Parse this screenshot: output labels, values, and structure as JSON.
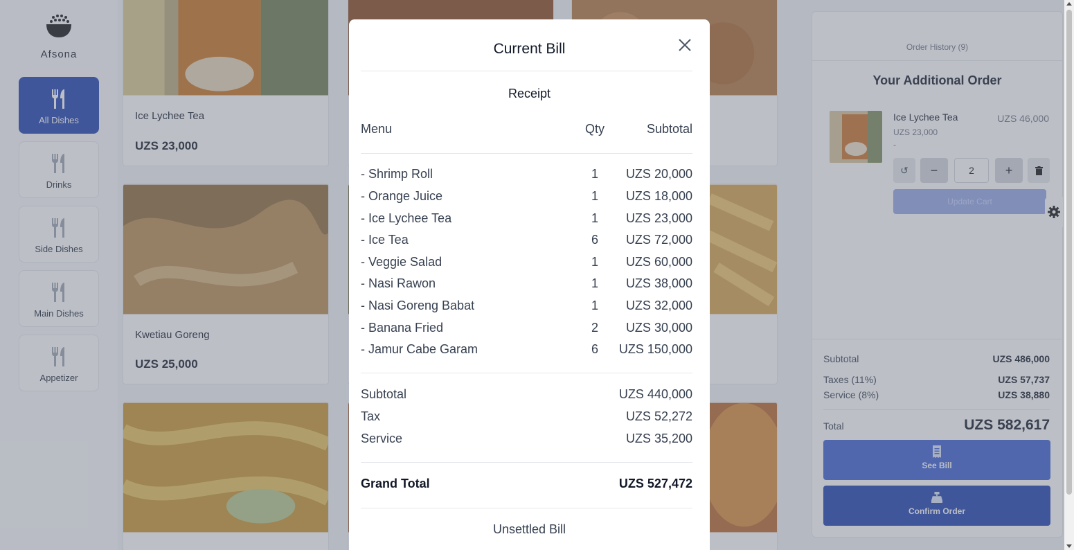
{
  "app": {
    "brand": "Afsona"
  },
  "categories": [
    {
      "label": "All Dishes",
      "icon": "utensils-icon",
      "active": true
    },
    {
      "label": "Drinks",
      "icon": "utensils-icon",
      "active": false
    },
    {
      "label": "Side Dishes",
      "icon": "utensils-icon",
      "active": false
    },
    {
      "label": "Main Dishes",
      "icon": "utensils-icon",
      "active": false
    },
    {
      "label": "Appetizer",
      "icon": "utensils-icon",
      "active": false
    }
  ],
  "menu_cards": [
    {
      "name": "Ice Lychee Tea",
      "price": "UZS 23,000"
    },
    {
      "name": "Kwetiau Goreng",
      "price": "UZS 25,000"
    }
  ],
  "cart": {
    "order_history": "Order History (9)",
    "title": "Your Additional Order",
    "item": {
      "name": "Ice Lychee Tea",
      "unit_price": "UZS 23,000",
      "note": "-",
      "total": "UZS 46,000",
      "qty": "2"
    },
    "update_label": "Update Cart",
    "subtotal_label": "Subtotal",
    "subtotal": "UZS 486,000",
    "tax_label": "Taxes (11%)",
    "tax": "UZS 57,737",
    "service_label": "Service (8%)",
    "service": "UZS 38,880",
    "total_label": "Total",
    "total": "UZS 582,617",
    "see_bill": "See Bill",
    "confirm": "Confirm Order"
  },
  "bill": {
    "title": "Current Bill",
    "receipt": "Receipt",
    "headers": {
      "menu": "Menu",
      "qty": "Qty",
      "subtotal": "Subtotal"
    },
    "items": [
      {
        "name": "- Shrimp Roll",
        "qty": "1",
        "subtotal": "UZS 20,000"
      },
      {
        "name": "- Orange Juice",
        "qty": "1",
        "subtotal": "UZS 18,000"
      },
      {
        "name": "- Ice Lychee Tea",
        "qty": "1",
        "subtotal": "UZS 23,000"
      },
      {
        "name": "- Ice Tea",
        "qty": "6",
        "subtotal": "UZS 72,000"
      },
      {
        "name": "- Veggie Salad",
        "qty": "1",
        "subtotal": "UZS 60,000"
      },
      {
        "name": "- Nasi Rawon",
        "qty": "1",
        "subtotal": "UZS 38,000"
      },
      {
        "name": "- Nasi Goreng Babat",
        "qty": "1",
        "subtotal": "UZS 32,000"
      },
      {
        "name": "- Banana Fried",
        "qty": "2",
        "subtotal": "UZS 30,000"
      },
      {
        "name": "- Jamur Cabe Garam",
        "qty": "6",
        "subtotal": "UZS 150,000"
      }
    ],
    "subtotal_label": "Subtotal",
    "subtotal": "UZS 440,000",
    "tax_label": "Tax",
    "tax": "UZS 52,272",
    "service_label": "Service",
    "service": "UZS 35,200",
    "grand_label": "Grand Total",
    "grand_total": "UZS 527,472",
    "status": "Unsettled Bill"
  }
}
